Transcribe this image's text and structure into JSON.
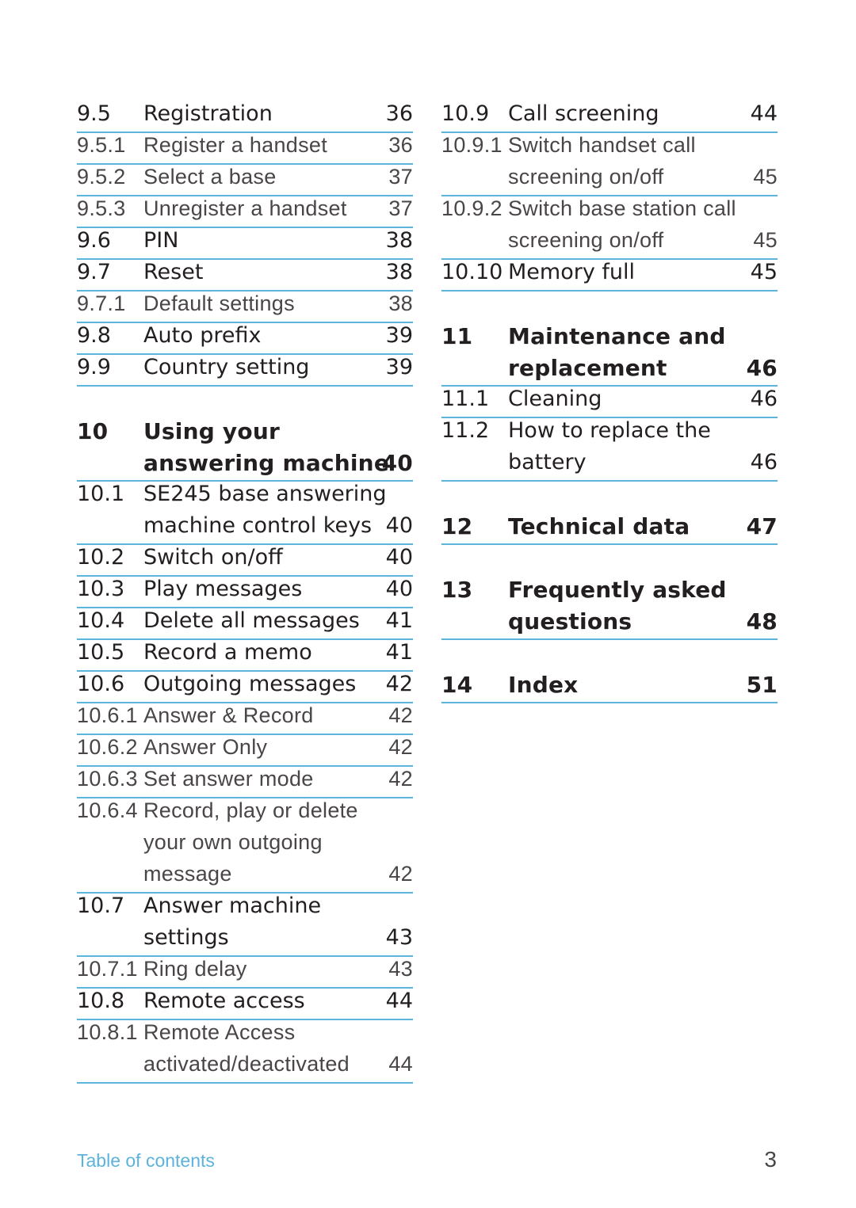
{
  "left_column": [
    {
      "level": "section",
      "num": "9.5",
      "lines": [
        "Registration"
      ],
      "page": "36"
    },
    {
      "level": "sub",
      "num": "9.5.1",
      "lines": [
        "Register a handset"
      ],
      "page": "36"
    },
    {
      "level": "sub",
      "num": "9.5.2",
      "lines": [
        "Select a base"
      ],
      "page": "37"
    },
    {
      "level": "sub",
      "num": "9.5.3",
      "lines": [
        "Unregister a handset"
      ],
      "page": "37"
    },
    {
      "level": "section",
      "num": "9.6",
      "lines": [
        "PIN"
      ],
      "page": "38"
    },
    {
      "level": "section",
      "num": "9.7",
      "lines": [
        "Reset"
      ],
      "page": "38"
    },
    {
      "level": "sub",
      "num": "9.7.1",
      "lines": [
        "Default settings"
      ],
      "page": "38"
    },
    {
      "level": "section",
      "num": "9.8",
      "lines": [
        "Auto prefix"
      ],
      "page": "39"
    },
    {
      "level": "section",
      "num": "9.9",
      "lines": [
        "Country setting"
      ],
      "page": "39"
    },
    {
      "level": "chapter",
      "num": "10",
      "lines": [
        "Using your",
        "answering machine"
      ],
      "page": "40"
    },
    {
      "level": "section",
      "num": "10.1",
      "lines": [
        "SE245 base answering",
        "machine control keys"
      ],
      "page": "40"
    },
    {
      "level": "section",
      "num": "10.2",
      "lines": [
        "Switch on/off"
      ],
      "page": "40"
    },
    {
      "level": "section",
      "num": "10.3",
      "lines": [
        "Play messages"
      ],
      "page": "40"
    },
    {
      "level": "section",
      "num": "10.4",
      "lines": [
        "Delete all messages"
      ],
      "page": "41"
    },
    {
      "level": "section",
      "num": "10.5",
      "lines": [
        "Record a memo"
      ],
      "page": "41"
    },
    {
      "level": "section",
      "num": "10.6",
      "lines": [
        "Outgoing messages"
      ],
      "page": "42"
    },
    {
      "level": "sub",
      "num": "10.6.1",
      "lines": [
        "Answer & Record"
      ],
      "page": "42"
    },
    {
      "level": "sub",
      "num": "10.6.2",
      "lines": [
        "Answer Only"
      ],
      "page": "42"
    },
    {
      "level": "sub",
      "num": "10.6.3",
      "lines": [
        "Set answer mode"
      ],
      "page": "42"
    },
    {
      "level": "sub",
      "num": "10.6.4",
      "lines": [
        "Record, play or delete",
        "your own outgoing",
        "message"
      ],
      "page": "42"
    },
    {
      "level": "section",
      "num": "10.7",
      "lines": [
        "Answer machine",
        "settings"
      ],
      "page": "43"
    },
    {
      "level": "sub",
      "num": "10.7.1",
      "lines": [
        "Ring delay"
      ],
      "page": "43"
    },
    {
      "level": "section",
      "num": "10.8",
      "lines": [
        "Remote access"
      ],
      "page": "44"
    },
    {
      "level": "sub",
      "num": "10.8.1",
      "lines": [
        "Remote Access",
        "activated/deactivated"
      ],
      "page": "44"
    }
  ],
  "right_column": [
    {
      "level": "section",
      "num": "10.9",
      "lines": [
        "Call screening"
      ],
      "page": "44"
    },
    {
      "level": "sub",
      "num": "10.9.1",
      "lines": [
        "Switch handset call",
        "screening on/off"
      ],
      "page": "45"
    },
    {
      "level": "sub",
      "num": "10.9.2",
      "lines": [
        "Switch base station call",
        "screening on/off"
      ],
      "page": "45"
    },
    {
      "level": "section",
      "num": "10.10",
      "lines": [
        "Memory full"
      ],
      "page": "45"
    },
    {
      "level": "chapter",
      "num": "11",
      "lines": [
        "Maintenance and",
        "replacement"
      ],
      "page": "46"
    },
    {
      "level": "section",
      "num": "11.1",
      "lines": [
        "Cleaning"
      ],
      "page": "46"
    },
    {
      "level": "section",
      "num": "11.2",
      "lines": [
        "How to replace the",
        "battery"
      ],
      "page": "46"
    },
    {
      "level": "chapter",
      "num": "12",
      "lines": [
        "Technical data"
      ],
      "page": "47"
    },
    {
      "level": "chapter",
      "num": "13",
      "lines": [
        "Frequently asked",
        "questions"
      ],
      "page": "48"
    },
    {
      "level": "chapter",
      "num": "14",
      "lines": [
        "Index"
      ],
      "page": "51"
    }
  ],
  "footer": {
    "section_label": "Table of contents",
    "page_number": "3",
    "accent_color": "#5cb3dc"
  }
}
